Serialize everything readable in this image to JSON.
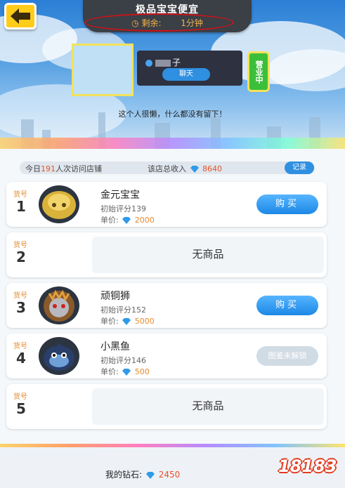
{
  "header": {
    "title": "极品宝宝便宜",
    "remaining_label": "剩余:",
    "remaining_value": "1分钟"
  },
  "shop": {
    "owner_name": "子",
    "chat_label": "聊天",
    "status_badge": "营业中",
    "motto": "这个人很懒，什么都没有留下！"
  },
  "stats": {
    "visits_prefix": "今日",
    "visits_count": "191",
    "visits_suffix": "人次访问店铺",
    "income_label": "该店总收入",
    "income_value": "8640",
    "record_label": "记录"
  },
  "slots": [
    {
      "label": "货号",
      "num": "1",
      "name": "金元宝宝",
      "score": "初始评分139",
      "price_label": "单价:",
      "price": "2000",
      "action": "购买",
      "icon": "gold-ingot-pet-icon"
    },
    {
      "label": "货号",
      "num": "2",
      "empty": "无商品"
    },
    {
      "label": "货号",
      "num": "3",
      "name": "顽铜狮",
      "score": "初始评分152",
      "price_label": "单价:",
      "price": "5000",
      "action": "购买",
      "icon": "bronze-lion-pet-icon"
    },
    {
      "label": "货号",
      "num": "4",
      "name": "小黑鱼",
      "score": "初始评分146",
      "price_label": "单价:",
      "price": "500",
      "action": "图鉴未解锁",
      "icon": "black-fish-pet-icon"
    },
    {
      "label": "货号",
      "num": "5",
      "empty": "无商品"
    }
  ],
  "footer": {
    "diamond_label": "我的钻石:",
    "diamond_value": "2450"
  },
  "logo": "18183",
  "colors": {
    "accent_blue": "#1c88e6",
    "price_orange": "#e8892c",
    "slot_label_orange": "#e0892c",
    "open_green": "#3bbf3b",
    "circle_red": "#c8141a"
  }
}
